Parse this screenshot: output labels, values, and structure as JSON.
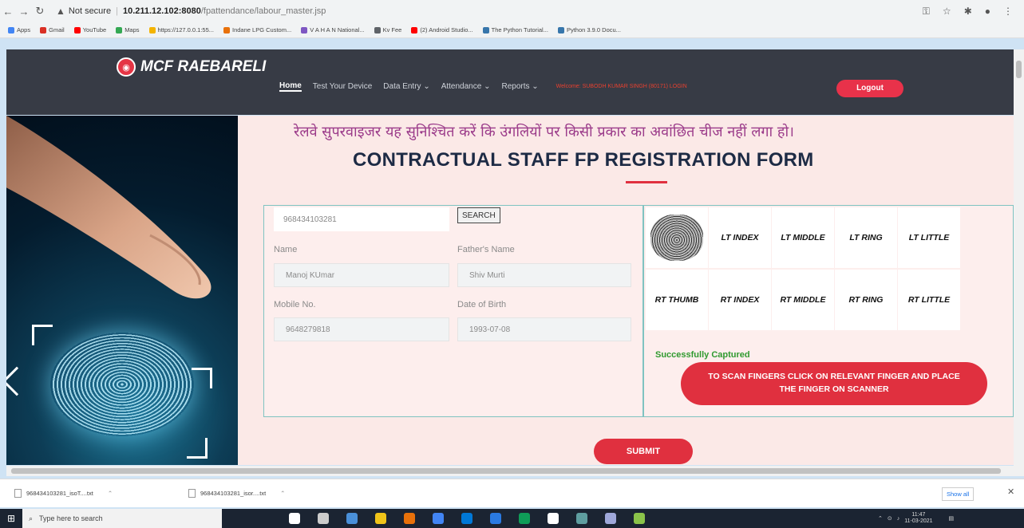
{
  "browser": {
    "url_warning": "Not secure",
    "url_host": "10.211.12.102:8080",
    "url_path": "/fpattendance/labour_master.jsp",
    "bookmarks": [
      {
        "label": "Apps",
        "color": "#4285f4"
      },
      {
        "label": "Gmail",
        "color": "#d93025"
      },
      {
        "label": "YouTube",
        "color": "#ff0000"
      },
      {
        "label": "Maps",
        "color": "#34a853"
      },
      {
        "label": "https://127.0.0.1:55...",
        "color": "#f4b400"
      },
      {
        "label": "Indane LPG Custom...",
        "color": "#e8710a"
      },
      {
        "label": "V A H A N National...",
        "color": "#7e57c2"
      },
      {
        "label": "Kv Fee",
        "color": "#5f6368"
      },
      {
        "label": "(2) Android Studio...",
        "color": "#ff0000"
      },
      {
        "label": "The Python Tutorial...",
        "color": "#3776ab"
      },
      {
        "label": "Python 3.9.0 Docu...",
        "color": "#3776ab"
      }
    ]
  },
  "header": {
    "logo_text": "MCF RAEBARELI",
    "menu": [
      {
        "label": "Home",
        "active": true
      },
      {
        "label": "Test Your Device",
        "active": false
      },
      {
        "label": "Data Entry ⌄",
        "active": false
      },
      {
        "label": "Attendance ⌄",
        "active": false
      },
      {
        "label": "Reports ⌄",
        "active": false
      }
    ],
    "welcome_text": "Welcome: SUBODH KUMAR SINGH (80171) LOGIN",
    "logout_label": "Logout"
  },
  "main": {
    "hindi_notice": "रेलवे सुपरवाइजर यह सुनिश्चित करें कि उंगलियों पर किसी प्रकार का अवांछित चीज नहीं लगा हो।",
    "title": "CONTRACTUAL STAFF FP REGISTRATION FORM",
    "form": {
      "aadhaar_value": "968434103281",
      "search_label": "SEARCH",
      "name_label": "Name",
      "name_value": "Manoj KUmar",
      "father_label": "Father's Name",
      "father_value": "Shiv Murti",
      "mobile_label": "Mobile No.",
      "mobile_value": "9648279818",
      "dob_label": "Date of Birth",
      "dob_value": "1993-07-08"
    },
    "fingers": {
      "row1": [
        "",
        "LT INDEX",
        "LT MIDDLE",
        "LT RING",
        "LT LITTLE"
      ],
      "row2": [
        "RT THUMB",
        "RT INDEX",
        "RT MIDDLE",
        "RT RING",
        "RT LITTLE"
      ]
    },
    "status": "Successfully Captured",
    "scan_instruction": "TO SCAN FINGERS CLICK ON RELEVANT FINGER AND PLACE THE FINGER ON SCANNER",
    "submit_label": "SUBMIT"
  },
  "downloads": {
    "items": [
      "968434103281_isoT....txt",
      "968434103281_isor....txt"
    ],
    "show_all": "Show all"
  },
  "taskbar": {
    "search_placeholder": "Type here to search",
    "time": "11:47",
    "date": "11-03-2021",
    "app_colors": [
      "#ffffff",
      "#cccccc",
      "#4a90d9",
      "#f0c419",
      "#e8710a",
      "#4285f4",
      "#0078d7",
      "#2a7ae2",
      "#0f9d58",
      "#ffffff",
      "#5f9ea0",
      "#9fa8da",
      "#8bc34a"
    ]
  }
}
